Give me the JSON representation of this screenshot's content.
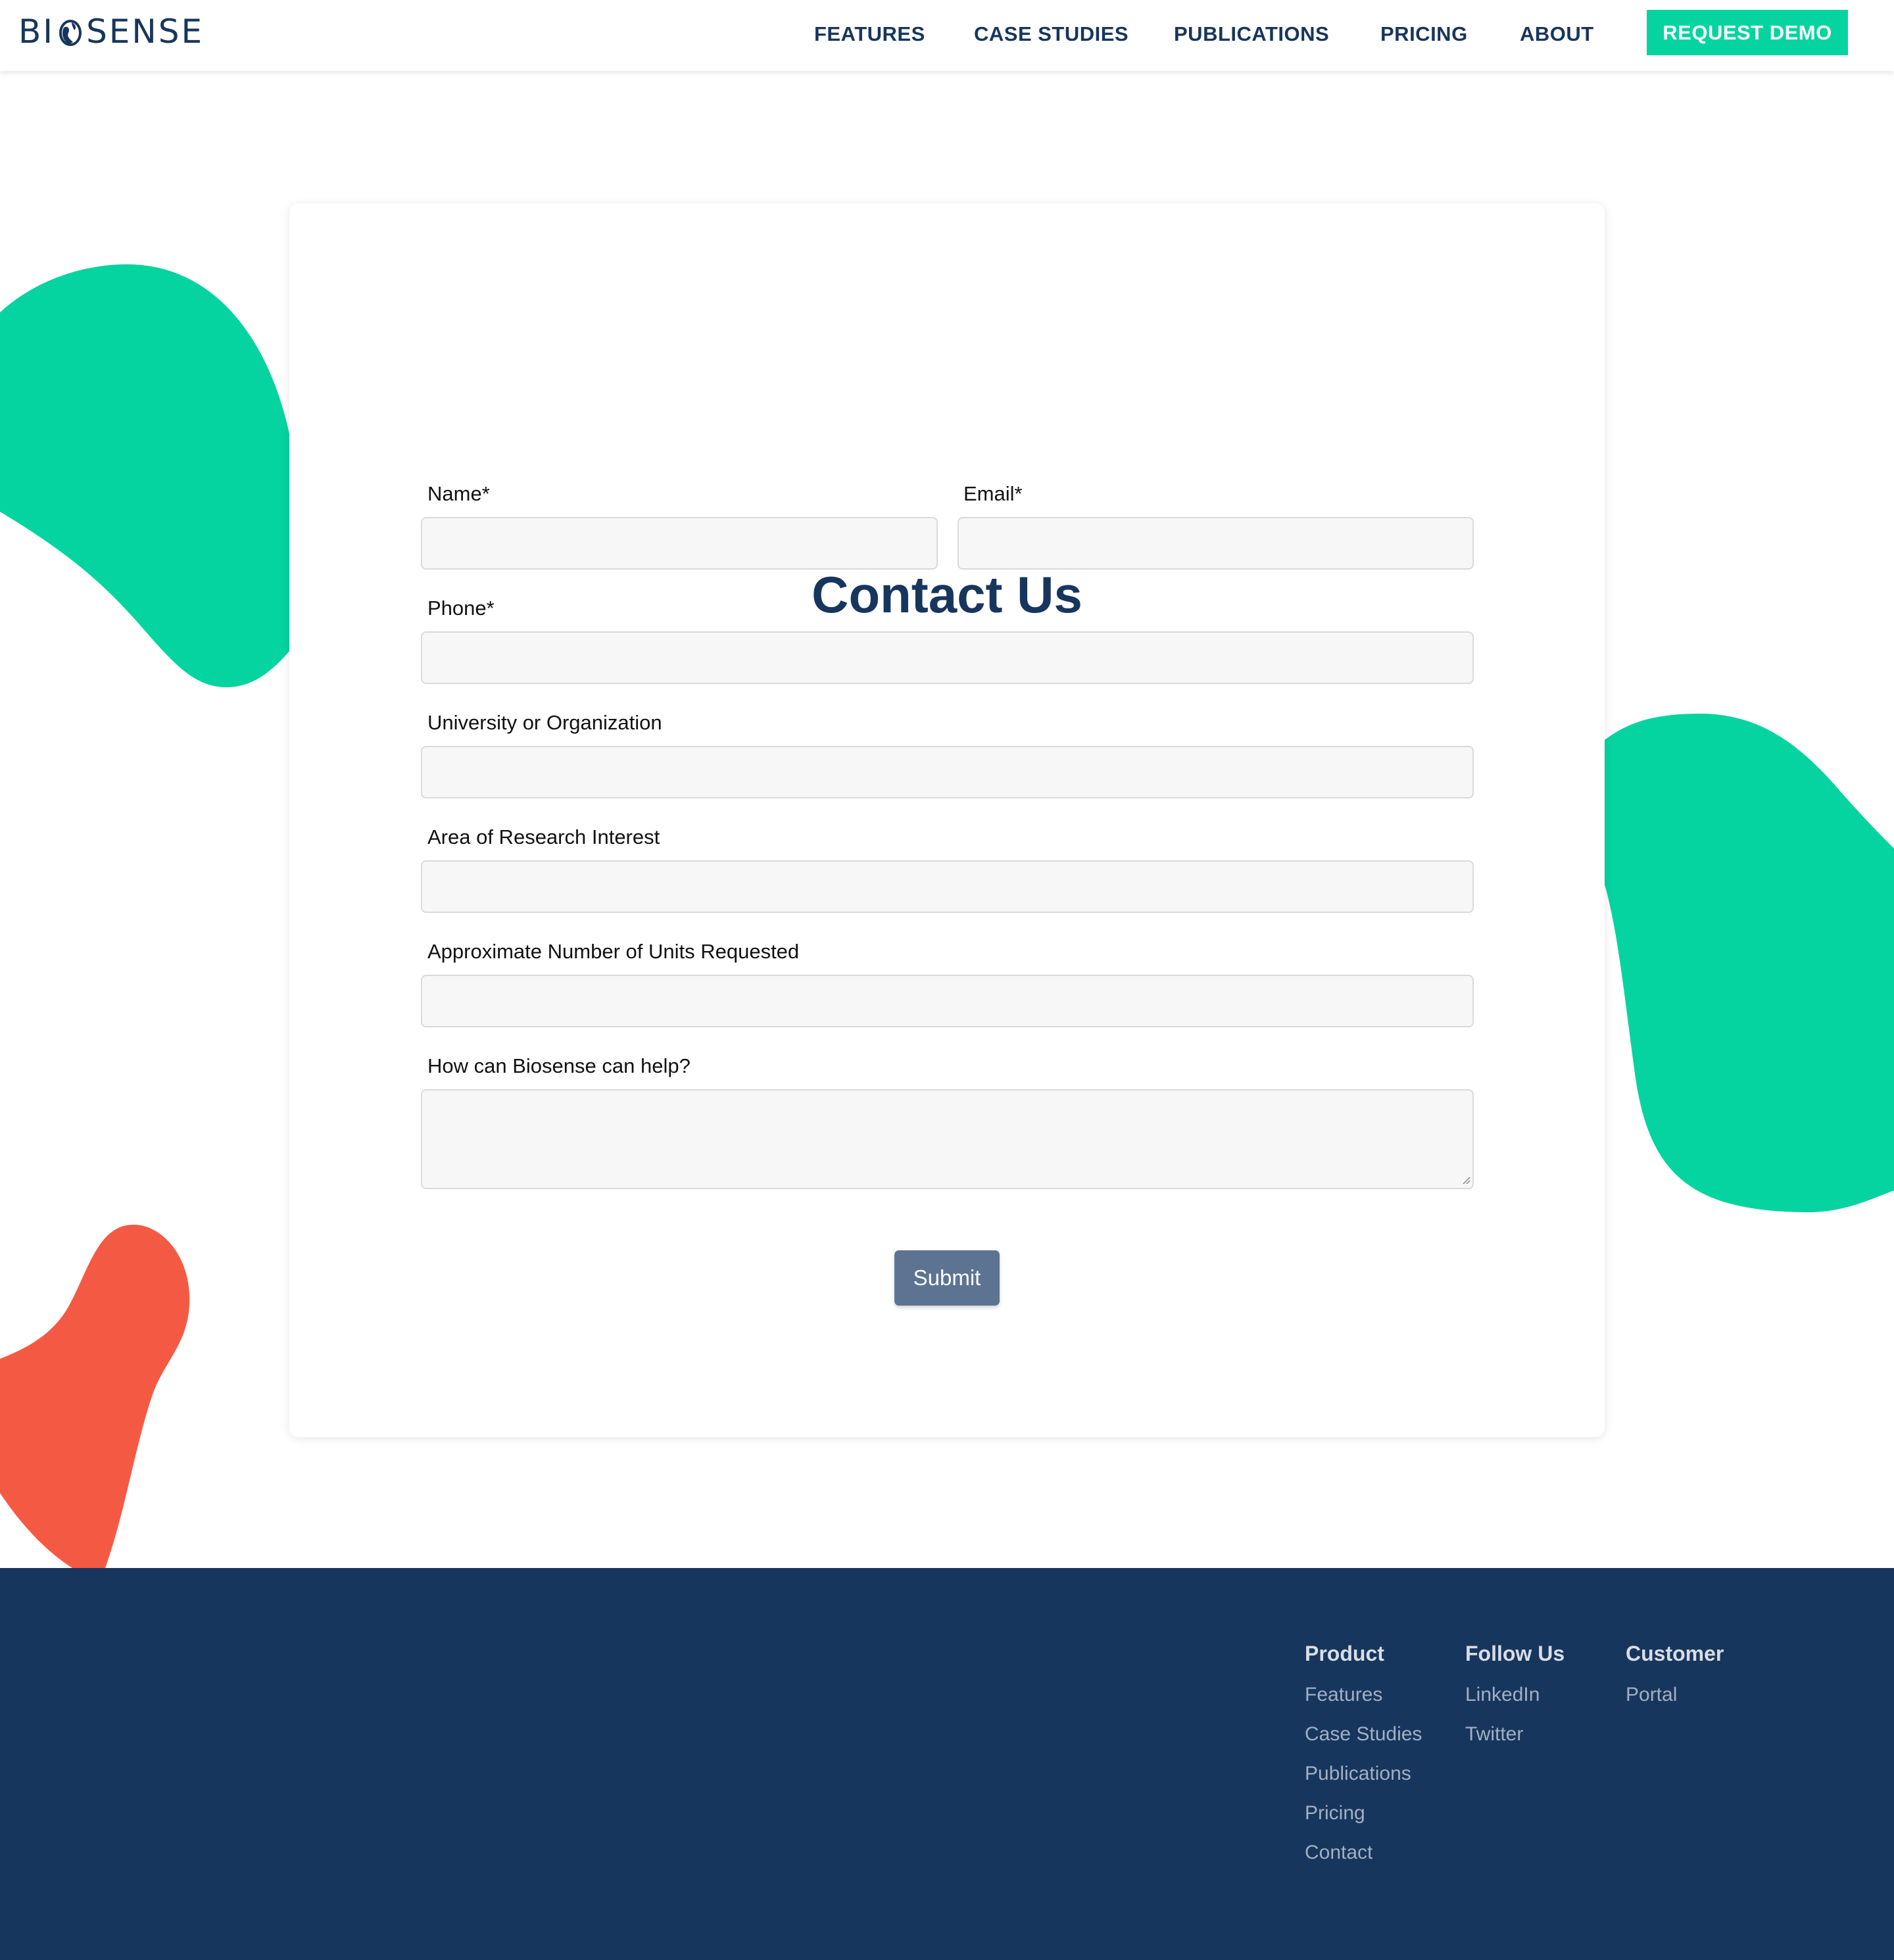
{
  "brand": {
    "logo_text_left": "BI",
    "logo_text_right": "SENSE",
    "logo_icon": "globe-icon"
  },
  "nav": {
    "items": [
      "FEATURES",
      "CASE STUDIES",
      "PUBLICATIONS",
      "PRICING",
      "ABOUT"
    ],
    "cta_label": "REQUEST DEMO"
  },
  "form": {
    "title": "Contact Us",
    "fields": {
      "name": {
        "label": "Name*",
        "value": ""
      },
      "email": {
        "label": "Email*",
        "value": ""
      },
      "phone": {
        "label": "Phone*",
        "value": ""
      },
      "organization": {
        "label": "University or Organization",
        "value": ""
      },
      "research_area": {
        "label": "Area of Research Interest",
        "value": ""
      },
      "units": {
        "label": "Approximate Number of Units Requested",
        "value": ""
      },
      "help": {
        "label": "How can Biosense can help?",
        "value": ""
      }
    },
    "submit_label": "Submit"
  },
  "footer": {
    "product": {
      "heading": "Product",
      "links": [
        "Features",
        "Case Studies",
        "Publications",
        "Pricing",
        "Contact"
      ]
    },
    "follow": {
      "heading": "Follow Us",
      "links": [
        "LinkedIn",
        "Twitter"
      ]
    },
    "customer": {
      "heading": "Customer",
      "links": [
        "Portal"
      ]
    }
  },
  "colors": {
    "brand_navy": "#17365d",
    "accent_green": "#05d4a0",
    "accent_coral": "#f45a43",
    "submit_button": "#5c7492",
    "footer_link": "#a2b0c3"
  }
}
